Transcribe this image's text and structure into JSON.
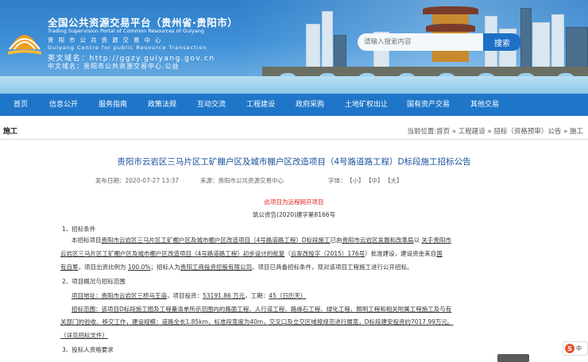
{
  "header": {
    "title_cn": "全国公共资源交易平台（贵州省·贵阳市）",
    "title_en": "Trading Supervision Portal of Common Resources of Guiyang",
    "sub_cn": "贵阳市公共资源交易中心",
    "sub_en": "Guiyang Centre for public Resource Transaction",
    "domain_en": "英文域名：http://ggzy.guiyang.gov.cn",
    "domain_cn": "中文域名：贵阳市公共资源交易中心.公益"
  },
  "search": {
    "placeholder": "请输入搜索内容",
    "button": "搜索"
  },
  "nav": {
    "items": [
      "首页",
      "信息公开",
      "服务指南",
      "政策法规",
      "互动交流",
      "工程建设",
      "政府采购",
      "土地矿权出让",
      "国有资产交易",
      "其他交易"
    ]
  },
  "breadcrumb": {
    "section": "施工",
    "path": "当前位置:首页 » 工程建设 » 招标（资格预审）公告 » 施工"
  },
  "article": {
    "title": "贵阳市云岩区三马片区工矿棚户区及城市棚户区改造项目（4号路道路工程）D标段施工招标公告",
    "publish_date": "发布日期：2020-07-27 13:37",
    "source": "来源：贵阳市公共资源交易中心",
    "font_label": "字体：",
    "font_small": "【小】",
    "font_medium": "【中】",
    "font_large": "【大】",
    "notice": "此项目为远程网开项目",
    "doc_no": "筑公资告(2020)建字第8166号",
    "s1_heading": "1、招标条件",
    "s1_p1a": "本招标项目",
    "s1_p1b": "贵阳市云岩区三马片区工矿棚户区及城市棚户区改造项目（4号路道路工程）D标段施工",
    "s1_p1c": "已由",
    "s1_p1d": "贵阳市云岩区发展和改革局",
    "s1_p1e": "以",
    "s1_p1f": "关于贵阳市",
    "s1_p2a": "云岩区三马片区工矿棚户区及城市棚户区改造项目（4号路道路工程）初步设计的批复",
    "s1_p2b": "（",
    "s1_p2c": "云发改投字（2015）176号",
    "s1_p2d": "）批准建设，建设资金来自",
    "s1_p2e": "国",
    "s1_p3a": "有自筹",
    "s1_p3b": "，项目出资比例为",
    "s1_p3c": "100.0%",
    "s1_p3d": "；招标人为",
    "s1_p3e": "贵阳工商投资控股有限公司",
    "s1_p3f": "。项目已具备招标条件，现对该项目工程施工进行公开招标。",
    "s2_heading": "2、项目概况与招标范围",
    "s2_p1a": "项目地址：贵阳市云岩区三桥马王庙",
    "s2_p1b": "，项目投资：",
    "s2_p1c": "53191.86 万元",
    "s2_p1d": "，工期：",
    "s2_p1e": "45（日历天）",
    "s2_p2a": "招标范围：该项目D标段施工图及工程量清单所示范围内的路面工程、人行道工程、路缘石工程、绿化工程、照明工程和相关附属工程施工及与有",
    "s2_p3a": "关部门的验收、移交工作，建设规模：道路全长1.85km，标准段宽度为40m，交叉口及立交区域按规范进行展宽，D标段建安投资约7017.99万元。",
    "s2_p4a": "（详见招标文件）",
    "s3_heading": "3、投标人资格要求"
  },
  "widget": {
    "icon": "S",
    "label": "中"
  }
}
